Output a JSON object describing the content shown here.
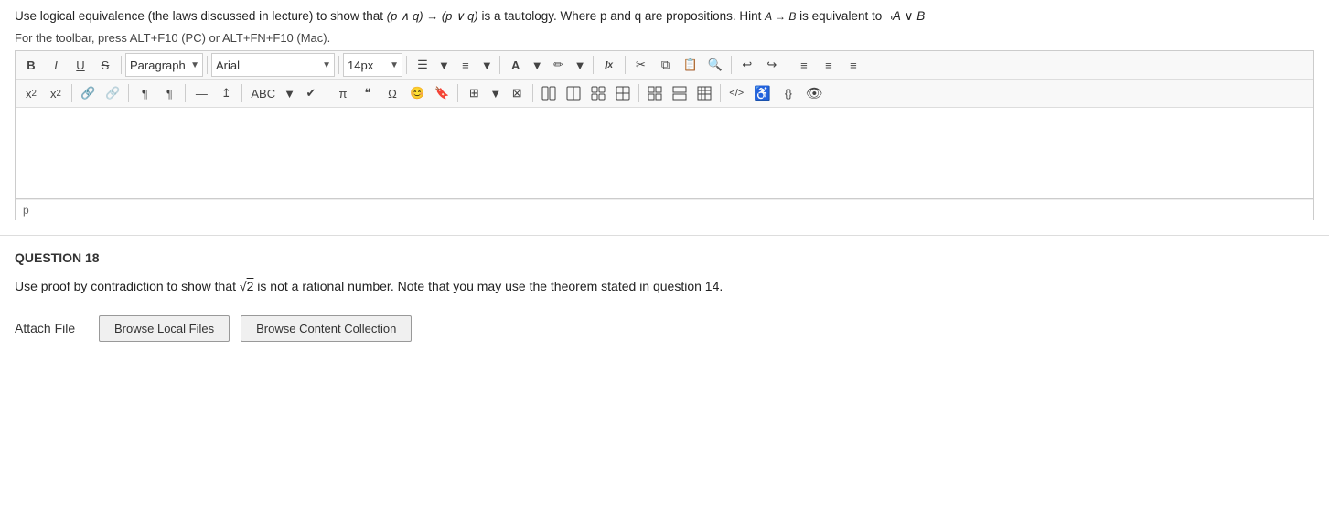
{
  "instructions": {
    "line1_prefix": "Use logical equivalence (the laws discussed in lecture) to show that ",
    "line1_formula": "(p ∧ q) → (p ∨ q)",
    "line1_suffix": " is a tautology. Where p and q are propositions. Hint ",
    "line1_hint_formula": "A → B",
    "line1_hint_suffix": " is equivalent to ¬A ∨ B",
    "line2": "For the toolbar, press ALT+F10 (PC) or ALT+FN+F10 (Mac)."
  },
  "toolbar": {
    "row1": {
      "bold": "B",
      "italic": "I",
      "underline": "U",
      "strikethrough": "S",
      "paragraph_label": "Paragraph",
      "font_label": "Arial",
      "size_label": "14px",
      "btn_ul": "≡",
      "btn_ol": "≡",
      "btn_color_a": "A",
      "btn_bg": "✎",
      "btn_clear": "Ix",
      "btn_cut": "✂",
      "btn_copy": "⧉",
      "btn_paste": "📋",
      "btn_search": "🔍",
      "btn_undo": "↩",
      "btn_redo": "↪",
      "btn_align_left": "≡",
      "btn_align_center": "≡",
      "btn_align_right": "≡"
    },
    "row2": {
      "btn_superscript": "x²",
      "btn_subscript": "x₂",
      "btn_link": "🔗",
      "btn_unlink": "🔗",
      "btn_indent": "¶",
      "btn_outdent": "¶",
      "btn_hr": "—",
      "btn_anchor": "↥",
      "btn_spellcheck": "ABC",
      "btn_check": "✔",
      "btn_formula": "π",
      "btn_quote": "❝",
      "btn_omega": "Ω",
      "btn_emoji": "😊",
      "btn_bookmark": "🔖",
      "btn_table": "⊞",
      "btn_table2": "⊠",
      "btn_code": "</>",
      "btn_accessibility": "♿",
      "btn_css": "{}"
    }
  },
  "editor": {
    "footer_label": "p"
  },
  "question18": {
    "header": "QUESTION 18",
    "text_prefix": "Use proof by contradiction to show that ",
    "formula": "√2",
    "text_suffix": " is not a rational number. Note that you may use the theorem stated in question 14.",
    "attach_label": "Attach File",
    "btn_browse_local": "Browse Local Files",
    "btn_browse_content": "Browse Content Collection"
  }
}
